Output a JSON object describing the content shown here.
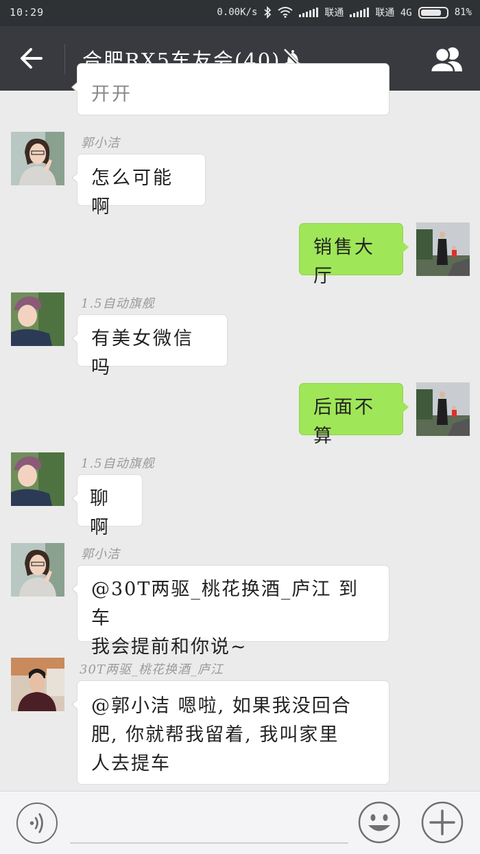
{
  "status_bar": {
    "time": "10:29",
    "speed": "0.00K/s",
    "carrier1": "联通",
    "carrier2": "联通 4G",
    "battery": "81%",
    "battery_level": 0.81,
    "icons": [
      "bluetooth-icon",
      "wifi-icon",
      "signal-icon",
      "battery-icon"
    ]
  },
  "header": {
    "title": "合肥RX5车友会(40)",
    "back_icon": "arrow-left-icon",
    "mute_icon": "bell-muted-icon",
    "members_icon": "group-icon"
  },
  "messages": [
    {
      "direction": "in",
      "sender": "",
      "text": "开开",
      "avatar": "woman-avatar"
    },
    {
      "direction": "in",
      "sender": "郭小洁",
      "text": "怎么可能啊",
      "avatar": "woman-avatar"
    },
    {
      "direction": "out",
      "sender": "",
      "text": "销售大厅",
      "avatar": "outdoor-avatar"
    },
    {
      "direction": "in",
      "sender": "1.5自动旗舰",
      "text": "有美女微信吗",
      "avatar": "child-avatar"
    },
    {
      "direction": "out",
      "sender": "",
      "text": "后面不算",
      "avatar": "outdoor-avatar"
    },
    {
      "direction": "in",
      "sender": "1.5自动旗舰",
      "text": "聊啊",
      "avatar": "child-avatar"
    },
    {
      "direction": "in",
      "sender": "郭小洁",
      "text_lines": [
        "@30T两驱_桃花换酒_庐江 到车",
        "我会提前和你说~"
      ],
      "avatar": "woman-avatar"
    },
    {
      "direction": "in",
      "sender": "30T两驱_桃花换酒_庐江",
      "text_lines": [
        "@郭小洁 嗯啦, 如果我没回合",
        "肥, 你就帮我留着, 我叫家里",
        "人去提车"
      ],
      "avatar": "man-avatar"
    }
  ],
  "input_bar": {
    "voice_icon": "voice-icon",
    "emoji_icon": "emoji-icon",
    "more_icon": "plus-icon"
  },
  "colors": {
    "status_bg": "#2f3235",
    "header_bg": "#393a3f",
    "chat_bg": "#ebebeb",
    "bubble_in": "#ffffff",
    "bubble_out": "#9fe658"
  }
}
